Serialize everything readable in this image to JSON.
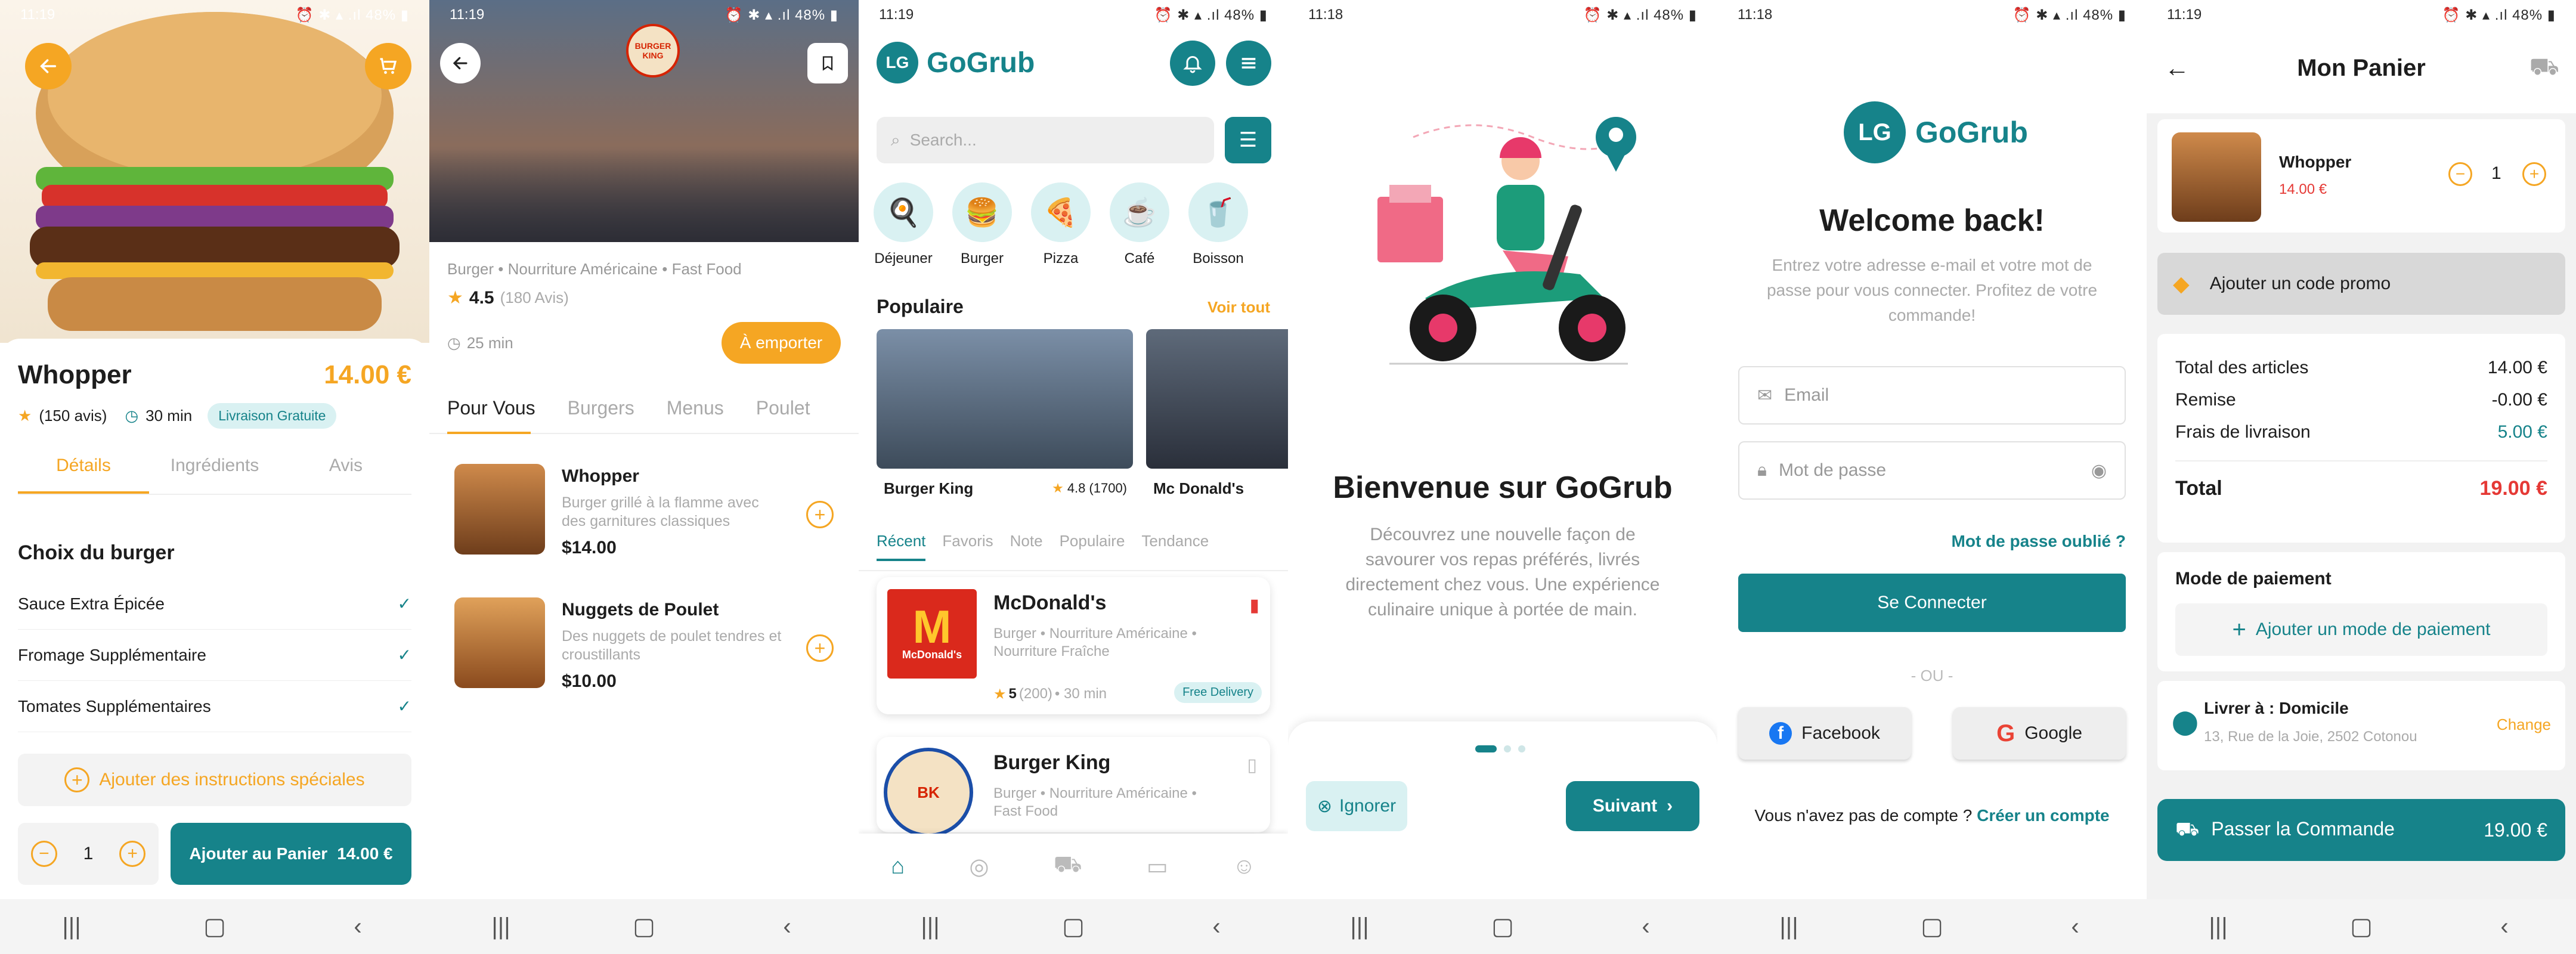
{
  "status": {
    "s1": "11:19",
    "s2": "11:19",
    "s3": "11:19",
    "s4": "11:18",
    "s5": "11:18",
    "s6": "11:19",
    "battery": "48%"
  },
  "detail": {
    "name": "Whopper",
    "price": "14.00 €",
    "reviews": "(150 avis)",
    "time": "30 min",
    "delivery_badge": "Livraison Gratuite",
    "tabs": [
      "Détails",
      "Ingrédients",
      "Avis"
    ],
    "section": "Choix du burger",
    "options": [
      "Sauce Extra Épicée",
      "Fromage Supplémentaire",
      "Tomates Supplémentaires"
    ],
    "add_instructions": "Ajouter des instructions spéciales",
    "qty": "1",
    "add_btn": "Ajouter au Panier",
    "add_btn_price": "14.00 €"
  },
  "restaurant": {
    "tags": "Burger • Nourriture Américaine • Fast Food",
    "rating": "4.5",
    "rating_count": "(180 Avis)",
    "time": "25 min",
    "takeaway": "À emporter",
    "tabs": [
      "Pour Vous",
      "Burgers",
      "Menus",
      "Poulet"
    ],
    "items": [
      {
        "name": "Whopper",
        "desc": "Burger grillé à la flamme avec des garnitures classiques",
        "price": "$14.00"
      },
      {
        "name": "Nuggets de Poulet",
        "desc": "Des nuggets de poulet tendres et croustillants",
        "price": "$10.00"
      }
    ],
    "logo_text": "BURGER KING"
  },
  "home": {
    "brand_initials": "LG",
    "brand": "GoGrub",
    "search_placeholder": "Search...",
    "categories": [
      {
        "label": "Déjeuner",
        "icon": "🍳"
      },
      {
        "label": "Burger",
        "icon": "🍔"
      },
      {
        "label": "Pizza",
        "icon": "🍕"
      },
      {
        "label": "Café",
        "icon": "☕"
      },
      {
        "label": "Boisson",
        "icon": "🥤"
      }
    ],
    "popular_title": "Populaire",
    "see_all": "Voir tout",
    "popular": [
      {
        "name": "Burger King",
        "rating": "4.8",
        "count": "(1700)"
      },
      {
        "name": "Mc Donald's"
      }
    ],
    "tabs": [
      "Récent",
      "Favoris",
      "Note",
      "Populaire",
      "Tendance"
    ],
    "restaurants": [
      {
        "name": "McDonald's",
        "tags": "Burger • Nourriture Américaine • Nourriture Fraîche",
        "rating": "5",
        "count": "(200)",
        "time": "• 30 min",
        "badge": "Free Delivery",
        "logo": "McDonald's"
      },
      {
        "name": "Burger King",
        "tags": "Burger • Nourriture Américaine • Fast Food"
      }
    ]
  },
  "onboarding": {
    "title": "Bienvenue sur GoGrub",
    "text": "Découvrez une nouvelle façon de savourer vos repas préférés, livrés directement chez vous. Une expérience culinaire unique à portée de main.",
    "skip": "Ignorer",
    "next": "Suivant"
  },
  "login": {
    "brand_initials": "LG",
    "brand": "GoGrub",
    "title": "Welcome back!",
    "subtitle": "Entrez votre adresse e-mail et votre mot de passe pour vous connecter. Profitez de votre commande!",
    "email_placeholder": "Email",
    "password_placeholder": "Mot de passe",
    "forgot": "Mot de passe oublié ?",
    "login_btn": "Se Connecter",
    "or": "- OU -",
    "facebook": "Facebook",
    "google": "Google",
    "no_account": "Vous n'avez pas de compte ?",
    "create": "Créer un compte"
  },
  "cart": {
    "title": "Mon Panier",
    "item_name": "Whopper",
    "item_price": "14.00 €",
    "qty": "1",
    "promo": "Ajouter un code promo",
    "rows": [
      {
        "label": "Total des articles",
        "value": "14.00 €"
      },
      {
        "label": "Remise",
        "value": "-0.00 €"
      },
      {
        "label": "Frais de livraison",
        "value": "5.00 €"
      }
    ],
    "total_label": "Total",
    "total_value": "19.00 €",
    "payment_title": "Mode de paiement",
    "add_payment": "Ajouter un mode de paiement",
    "deliver_title": "Livrer à : Domicile",
    "address": "13, Rue de la Joie, 2502 Cotonou",
    "change": "Change",
    "order_btn": "Passer la Commande",
    "order_total": "19.00 €"
  },
  "colors": {
    "teal": "#16838a",
    "orange": "#f5a623",
    "red": "#e53935"
  }
}
